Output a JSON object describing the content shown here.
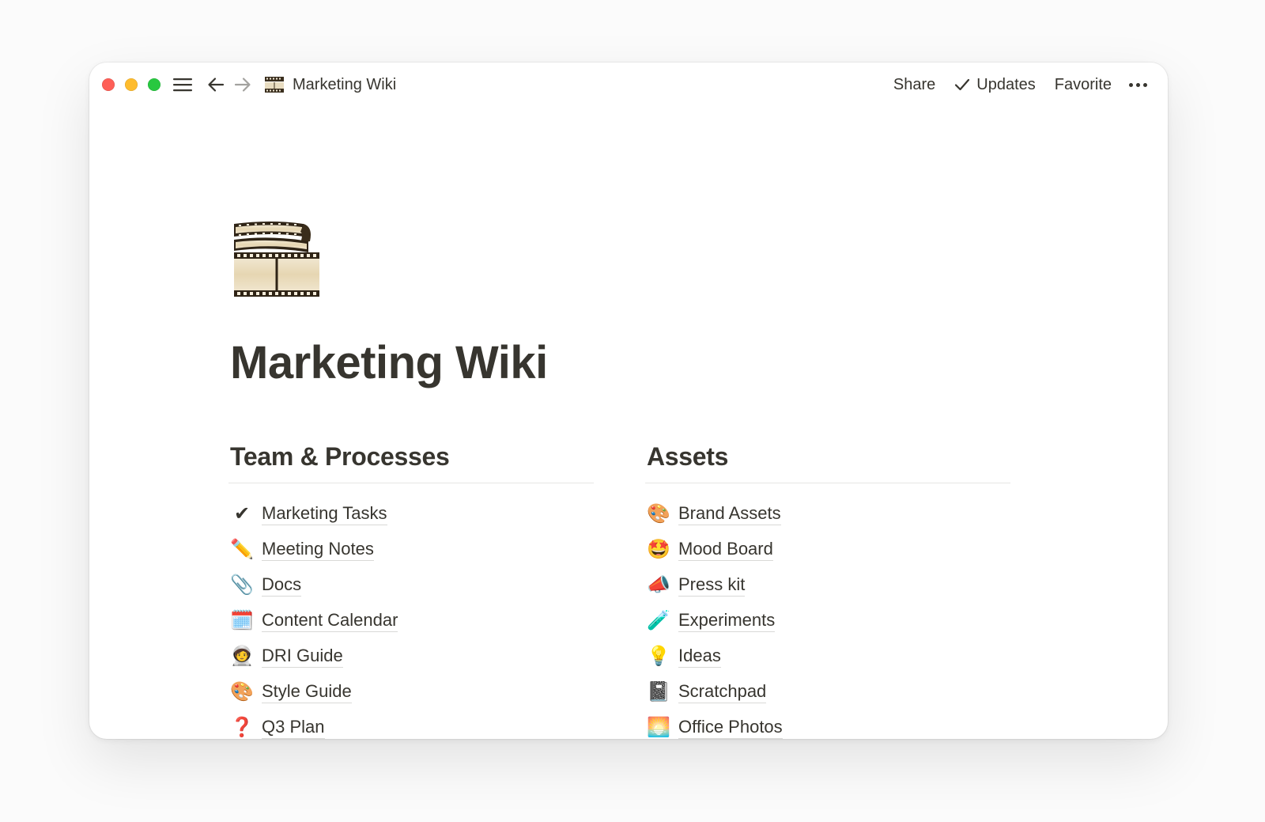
{
  "titlebar": {
    "breadcrumb_title": "Marketing Wiki",
    "share_label": "Share",
    "updates_label": "Updates",
    "favorite_label": "Favorite"
  },
  "page": {
    "icon": "film-strip-icon",
    "title": "Marketing Wiki"
  },
  "columns": [
    {
      "heading": "Team & Processes",
      "items": [
        {
          "emoji": "✔",
          "label": "Marketing Tasks"
        },
        {
          "emoji": "✏️",
          "label": "Meeting Notes"
        },
        {
          "emoji": "📎",
          "label": "Docs"
        },
        {
          "emoji": "🗓️",
          "label": "Content Calendar"
        },
        {
          "emoji": "🧑‍🚀",
          "label": "DRI Guide"
        },
        {
          "emoji": "🎨",
          "label": "Style Guide"
        },
        {
          "emoji": "❓",
          "label": "Q3 Plan"
        }
      ]
    },
    {
      "heading": "Assets",
      "items": [
        {
          "emoji": "🎨",
          "label": "Brand Assets"
        },
        {
          "emoji": "🤩",
          "label": "Mood Board"
        },
        {
          "emoji": "📣",
          "label": "Press kit"
        },
        {
          "emoji": "🧪",
          "label": "Experiments"
        },
        {
          "emoji": "💡",
          "label": "Ideas"
        },
        {
          "emoji": "📓",
          "label": "Scratchpad"
        },
        {
          "emoji": "🌅",
          "label": "Office Photos"
        }
      ]
    }
  ],
  "colors": {
    "text": "#37352f",
    "traffic_red": "#fe5f57",
    "traffic_yellow": "#febc2e",
    "traffic_green": "#28c840"
  }
}
